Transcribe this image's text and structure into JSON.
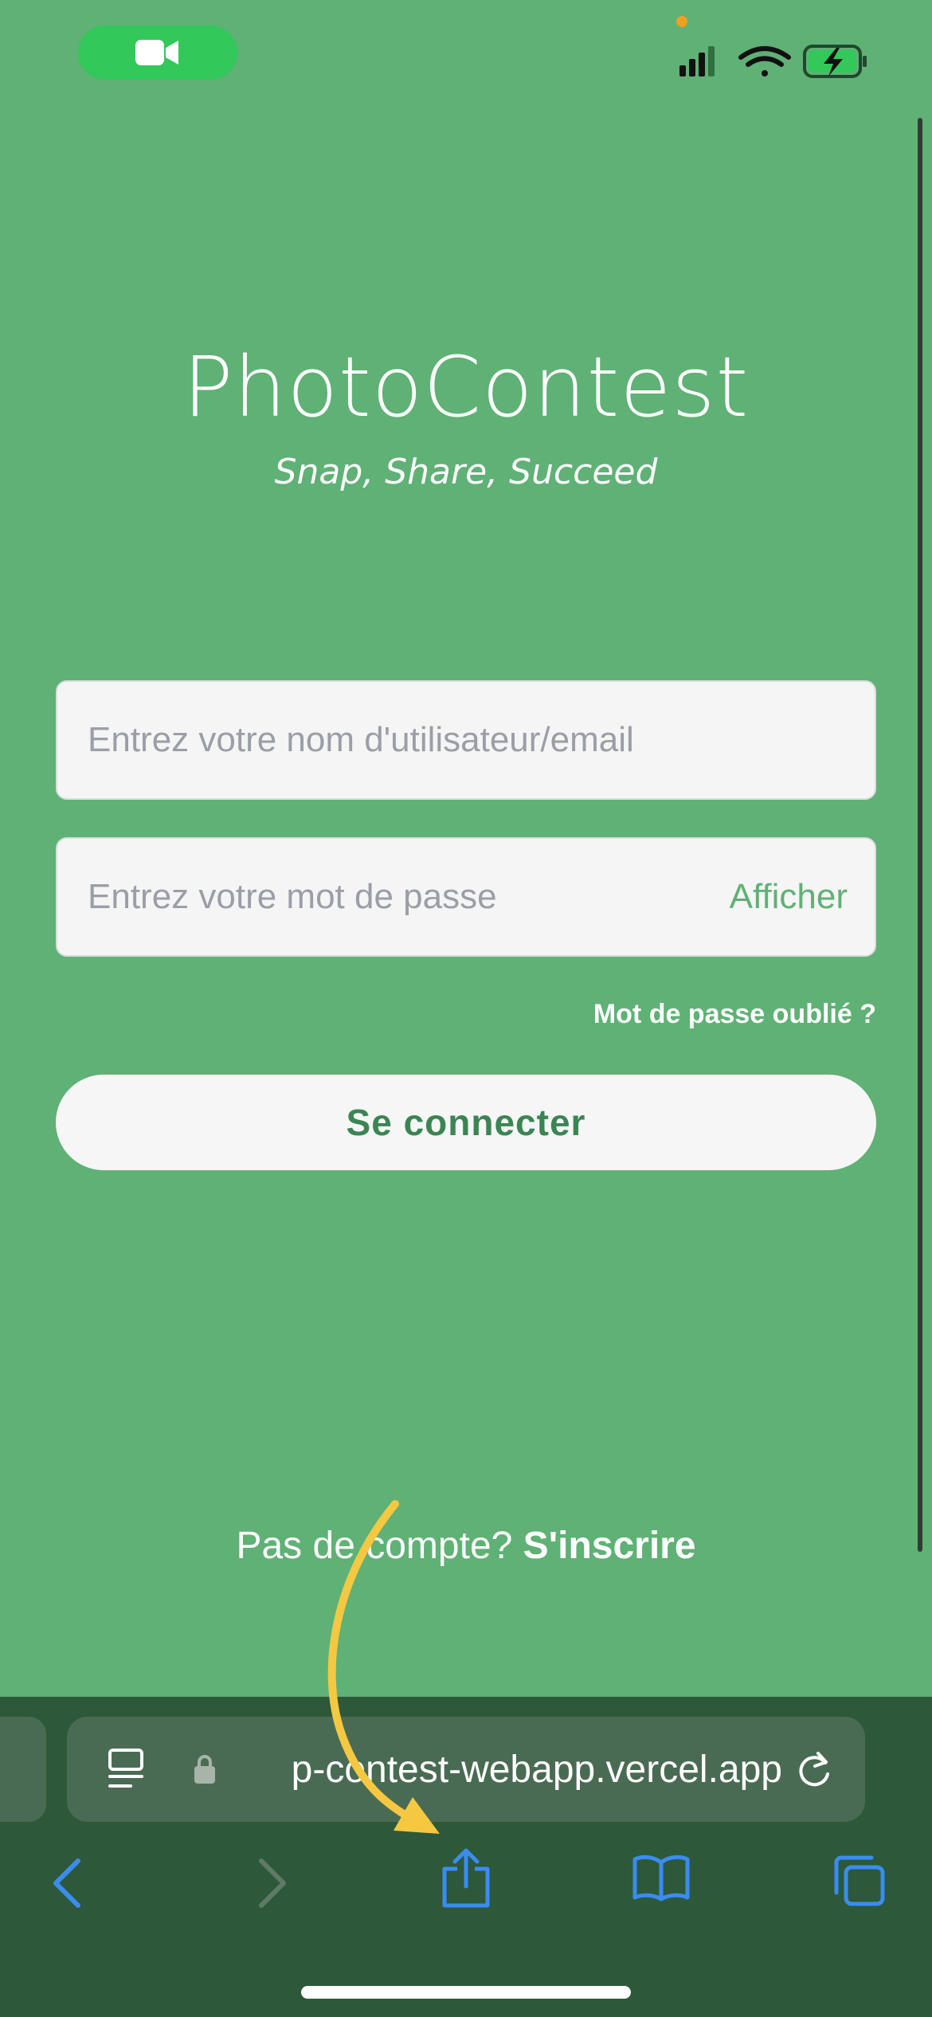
{
  "status_bar": {
    "icons": [
      "facetime-video-icon",
      "cellular-signal-icon",
      "wifi-icon",
      "battery-charging-icon"
    ]
  },
  "app": {
    "title": "PhotoContest",
    "tagline": "Snap, Share, Succeed"
  },
  "login_form": {
    "username_placeholder": "Entrez votre nom d'utilisateur/email",
    "password_placeholder": "Entrez votre mot de passe",
    "show_password_label": "Afficher",
    "forgot_password_label": "Mot de passe oublié ?",
    "submit_label": "Se connecter"
  },
  "signup": {
    "prompt": "Pas de compte?",
    "link_label": "S'inscrire"
  },
  "browser": {
    "url_visible": "p-contest-webapp.vercel.app",
    "toolbar_icons": [
      "back-icon",
      "forward-icon",
      "share-icon",
      "bookmarks-icon",
      "tabs-icon"
    ]
  },
  "colors": {
    "page_background": "#5fb175",
    "accent_green": "#3b8553",
    "browser_bar": "#2d5839",
    "toolbar_blue": "#3a8cf0",
    "annotation_arrow": "#f5c842"
  }
}
